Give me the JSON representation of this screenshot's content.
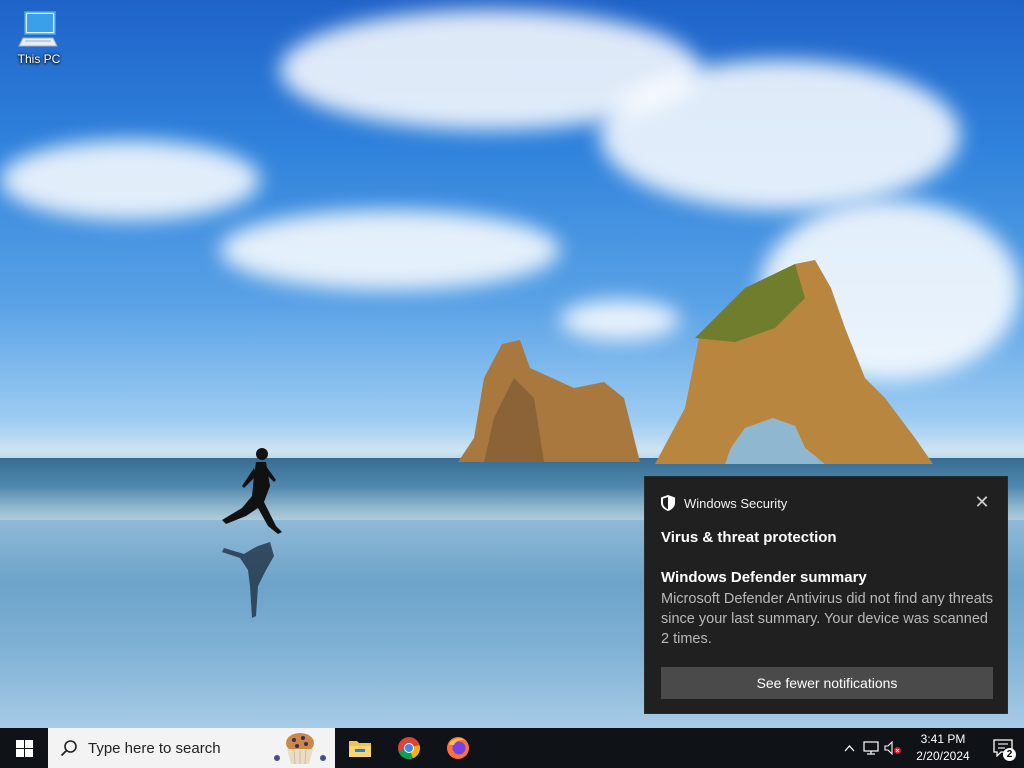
{
  "desktop": {
    "icons": [
      {
        "label": "This PC",
        "icon": "monitor-icon"
      }
    ]
  },
  "notification": {
    "app_name": "Windows Security",
    "app_icon": "shield-icon",
    "close_symbol": "✕",
    "title": "Virus & threat protection",
    "subtitle": "Windows Defender summary",
    "body": "Microsoft Defender Antivirus did not find any threats since your last summary.  Your device was scanned 2 times.",
    "button_label": "See fewer notifications",
    "background_color": "#202020",
    "button_color": "#4a4a4a"
  },
  "taskbar": {
    "search_placeholder": "Type here to search",
    "pinned_apps": [
      "file-explorer-icon",
      "chrome-icon",
      "firefox-icon"
    ],
    "tray": {
      "time": "3:41 PM",
      "date": "2/20/2024",
      "notification_count": "2"
    },
    "background_color": "#0f1216"
  }
}
